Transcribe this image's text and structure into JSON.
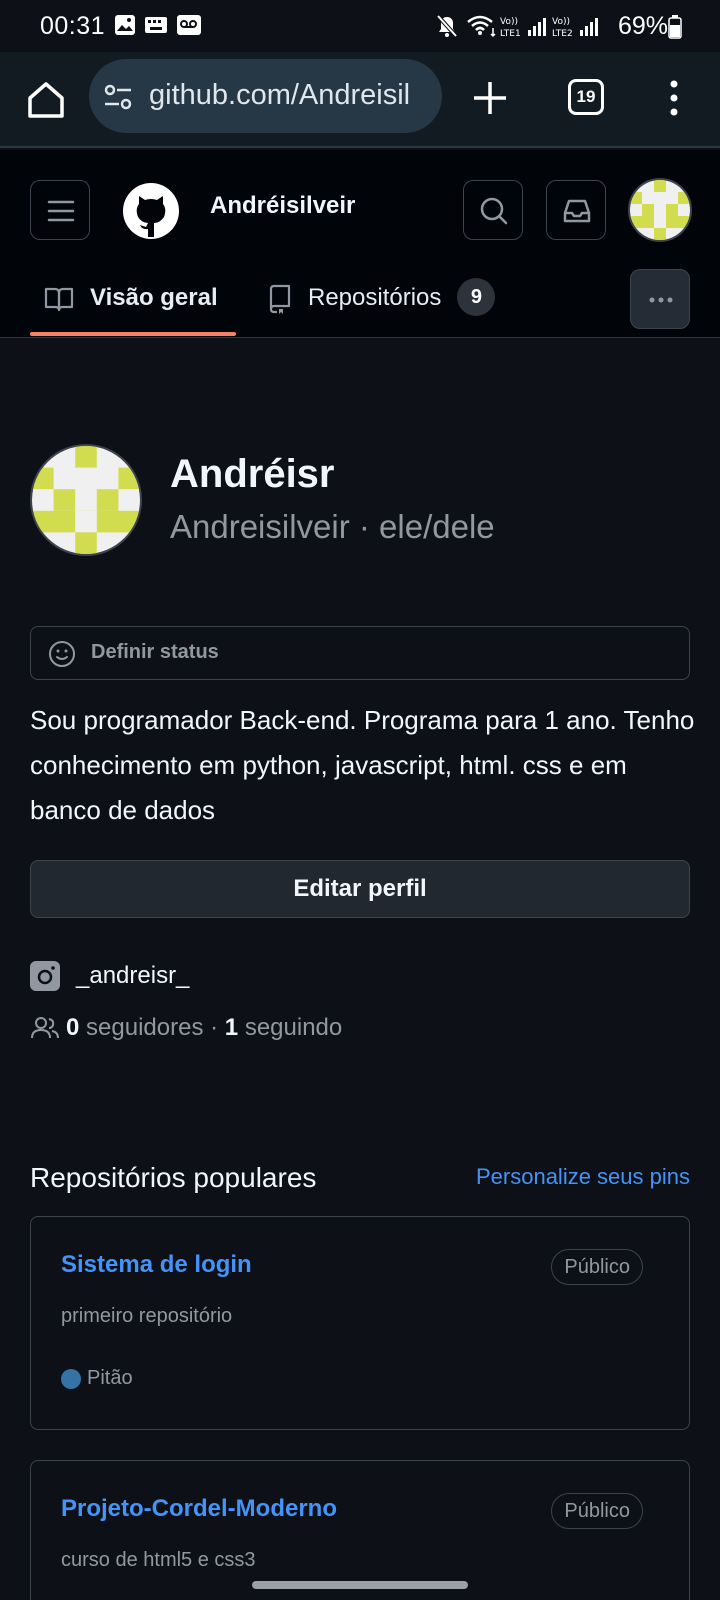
{
  "status_bar": {
    "time": "00:31",
    "battery": "69%",
    "icons": [
      "gallery-icon",
      "keyboard-icon",
      "voicemail-icon",
      "mute-icon",
      "wifi-icon",
      "signal-lte1-icon",
      "signal-lte2-icon",
      "battery-icon"
    ]
  },
  "browser": {
    "url": "github.com/Andreisil",
    "tab_count": "19",
    "icons": [
      "home-icon",
      "site-settings-icon",
      "new-tab-icon",
      "tabs-icon",
      "menu-icon"
    ]
  },
  "header": {
    "username": "Andréisilveir",
    "tabs": [
      {
        "label": "Visão geral",
        "icon": "book-icon",
        "selected": true
      },
      {
        "label": "Repositórios",
        "icon": "repo-icon",
        "count": "9"
      }
    ]
  },
  "profile": {
    "name": "Andréisr",
    "login_line": "Andreisilveir · ele/dele",
    "status_placeholder": "Definir status",
    "bio": "Sou programador Back-end. Programa para 1 ano. Tenho conhecimento em python, javascript, html. css e em banco de dados",
    "edit_button": "Editar perfil",
    "social_handle": "_andreisr_",
    "followers_count": "0",
    "followers_label": "seguidores",
    "separator": "·",
    "following_count": "1",
    "following_label": "seguindo"
  },
  "pinned": {
    "title": "Repositórios populares",
    "customize_link": "Personalize seus pins",
    "repos": [
      {
        "name": "Sistema de login",
        "visibility": "Público",
        "description": "primeiro repositório",
        "language": "Pitão",
        "language_color": "#3572A5"
      },
      {
        "name": "Projeto-Cordel-Moderno",
        "visibility": "Público",
        "description": "curso de html5 e css3"
      }
    ]
  },
  "colors": {
    "background": "#0d1117",
    "header_bg": "#010409",
    "link": "#4493f8",
    "tab_underline": "#f78166",
    "avatar_fill": "#d2dc4f",
    "avatar_bg": "#f0f0f0"
  }
}
